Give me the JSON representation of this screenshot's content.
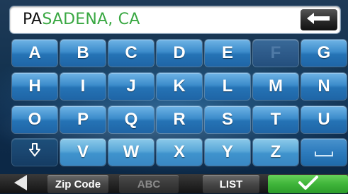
{
  "search": {
    "typed_text": "PA",
    "suggestion_text": "SADENA, CA"
  },
  "keyboard": {
    "rows": [
      [
        "A",
        "B",
        "C",
        "D",
        "E",
        "F",
        "G"
      ],
      [
        "H",
        "I",
        "J",
        "K",
        "L",
        "M",
        "N"
      ],
      [
        "O",
        "P",
        "Q",
        "R",
        "S",
        "T",
        "U"
      ],
      [
        "V",
        "W",
        "X",
        "Y",
        "Z"
      ]
    ],
    "disabled_keys": [
      "F"
    ],
    "shift_icon": "shift-down-arrow-icon",
    "space_icon": "space-bar-icon",
    "backspace_icon": "backspace-arrow-icon"
  },
  "bottom_bar": {
    "back_icon": "back-arrow-icon",
    "zip_code_label": "Zip Code",
    "abc_label": "ABC",
    "list_label": "LIST",
    "confirm_icon": "checkmark-icon"
  },
  "colors": {
    "suggestion_text": "#3aa843",
    "key_blue": "#3c8ccb",
    "confirm_green": "#3fb53a"
  }
}
